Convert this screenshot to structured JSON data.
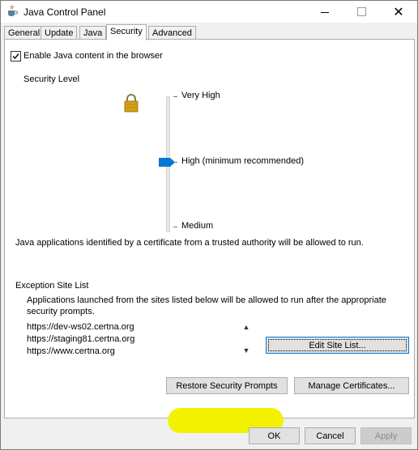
{
  "window": {
    "title": "Java Control Panel",
    "close_glyph": "✕"
  },
  "tabs": [
    {
      "label": "General"
    },
    {
      "label": "Update"
    },
    {
      "label": "Java"
    },
    {
      "label": "Security",
      "active": true
    },
    {
      "label": "Advanced"
    }
  ],
  "security": {
    "enable_java_label": "Enable Java content in the browser",
    "enable_java_checked": true,
    "security_level_heading": "Security Level",
    "levels": {
      "very_high": "Very High",
      "high": "High (minimum recommended)",
      "medium": "Medium"
    },
    "selected_level": "High (minimum recommended)",
    "level_description": "Java applications identified by a certificate from a trusted authority will be allowed to run.",
    "exception_heading": "Exception Site List",
    "exception_desc_line1": "Applications launched from the sites listed below will be allowed to run after the appropriate",
    "exception_desc_line2": "security prompts.",
    "sites": [
      "https://dev-ws02.certna.org",
      "https://staging81.certna.org",
      "https://www.certna.org"
    ],
    "edit_site_list_label": "Edit Site List...",
    "restore_prompts_label": "Restore Security Prompts",
    "manage_certificates_label": "Manage Certificates..."
  },
  "footer": {
    "ok_label": "OK",
    "cancel_label": "Cancel",
    "apply_label": "Apply"
  },
  "colors": {
    "highlight": "#f2f200",
    "slider_thumb": "#0078d7",
    "lock": "#d4a017"
  }
}
